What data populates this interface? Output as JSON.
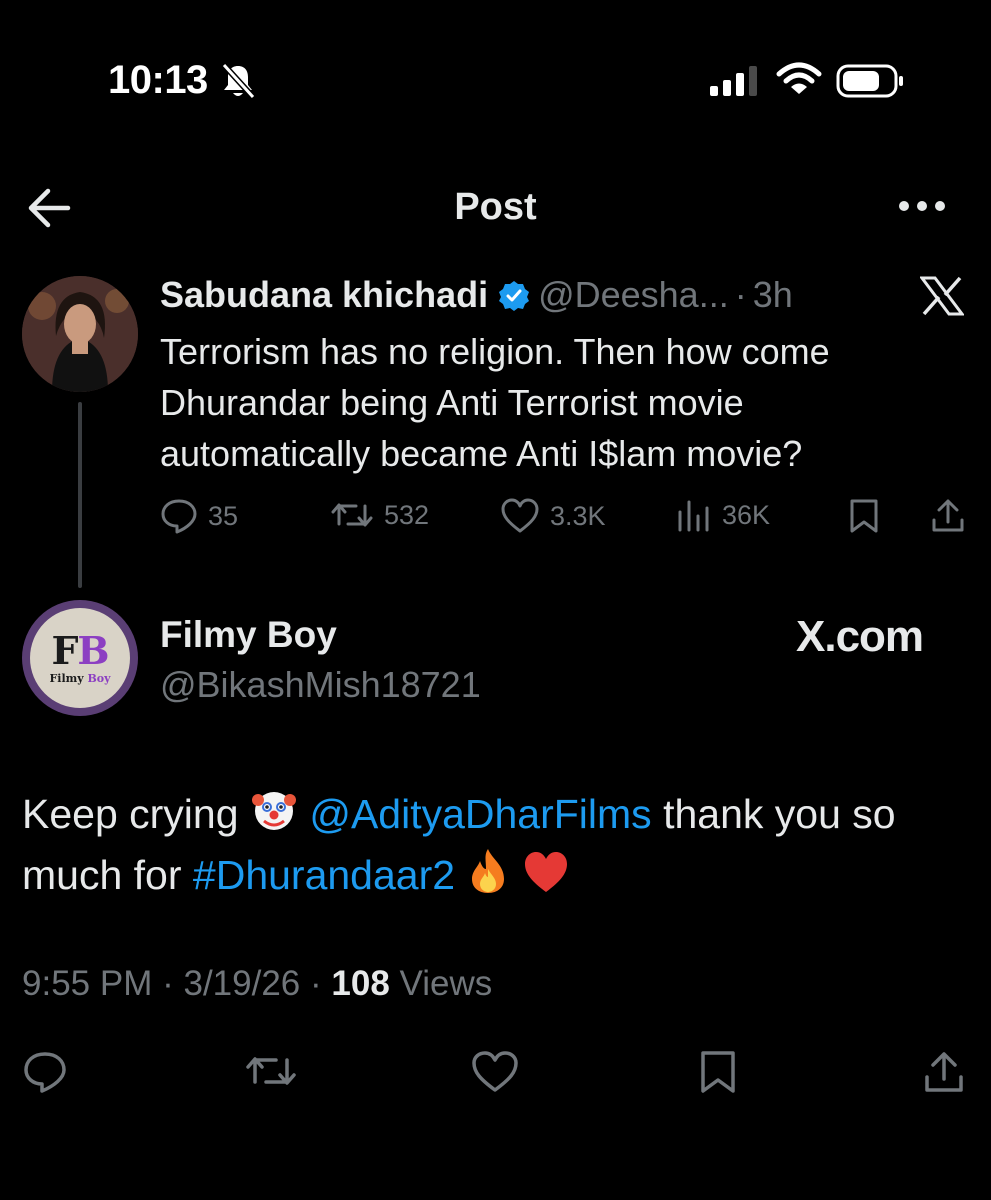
{
  "status_bar": {
    "time": "10:13"
  },
  "header": {
    "title": "Post"
  },
  "quoted_tweet": {
    "name": "Sabudana khichadi",
    "handle": "@Deesha...",
    "separator": "·",
    "age": "3h",
    "text": "Terrorism has no religion. Then how come Dhurandar being Anti Terrorist movie automatically became Anti I$lam movie?",
    "replies": "35",
    "reposts": "532",
    "likes": "3.3K",
    "views": "36K",
    "accent_color": "#1d9bf0"
  },
  "main_tweet": {
    "name": "Filmy Boy",
    "handle": "@BikashMish18721",
    "watermark": "X.com",
    "avatar": {
      "letters_1": "F",
      "letters_2": "B",
      "sub_1": "Filmy",
      "sub_2": "Boy"
    },
    "text_1": "Keep crying",
    "mention": "@AdityaDharFilms",
    "text_2": "thank you so much for",
    "hashtag": "#Dhurandaar2",
    "time": "9:55 PM",
    "date": "3/19/26",
    "sep": "·",
    "views_count": "108",
    "views_label": "Views"
  },
  "colors": {
    "background": "#000000",
    "text": "#e7e9ea",
    "muted": "#71767b",
    "link": "#1d9bf0"
  },
  "icons": [
    "bell-slash-icon",
    "signal-icon",
    "wifi-icon",
    "battery-icon",
    "back-arrow-icon",
    "more-icon",
    "verified-icon",
    "x-logo-icon",
    "reply-icon",
    "repost-icon",
    "like-icon",
    "views-icon",
    "bookmark-icon",
    "share-icon",
    "clown-emoji",
    "fire-emoji",
    "heart-emoji"
  ]
}
